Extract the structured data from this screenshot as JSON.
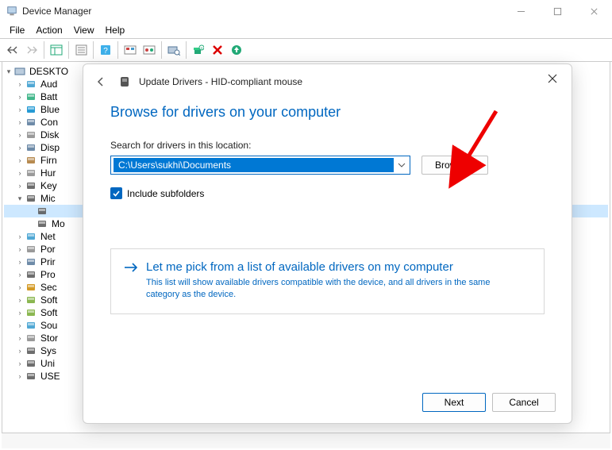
{
  "window": {
    "title": "Device Manager",
    "menu": [
      "File",
      "Action",
      "View",
      "Help"
    ]
  },
  "tree": {
    "root": "DESKTO",
    "items": [
      {
        "label": "Aud",
        "icon": "audio"
      },
      {
        "label": "Batt",
        "icon": "battery"
      },
      {
        "label": "Blue",
        "icon": "bluetooth"
      },
      {
        "label": "Con",
        "icon": "computer"
      },
      {
        "label": "Disk",
        "icon": "disk"
      },
      {
        "label": "Disp",
        "icon": "display"
      },
      {
        "label": "Firn",
        "icon": "firmware"
      },
      {
        "label": "Hur",
        "icon": "hid"
      },
      {
        "label": "Key",
        "icon": "keyboard"
      },
      {
        "label": "Mic",
        "icon": "mouse",
        "expanded": true,
        "children": [
          {
            "label": "",
            "icon": "mouse",
            "selected": true
          },
          {
            "label": "Mo",
            "icon": "mouse"
          }
        ]
      },
      {
        "label": "Net",
        "icon": "network"
      },
      {
        "label": "Por",
        "icon": "ports"
      },
      {
        "label": "Prir",
        "icon": "print"
      },
      {
        "label": "Pro",
        "icon": "cpu"
      },
      {
        "label": "Sec",
        "icon": "security"
      },
      {
        "label": "Soft",
        "icon": "soft"
      },
      {
        "label": "Soft",
        "icon": "soft"
      },
      {
        "label": "Sou",
        "icon": "sound"
      },
      {
        "label": "Stor",
        "icon": "storage"
      },
      {
        "label": "Sys",
        "icon": "system"
      },
      {
        "label": "Uni",
        "icon": "usb"
      },
      {
        "label": "USE",
        "icon": "usb"
      }
    ]
  },
  "dialog": {
    "title": "Update Drivers - HID-compliant mouse",
    "heading": "Browse for drivers on your computer",
    "location_label": "Search for drivers in this location:",
    "location_value": "C:\\Users\\sukhi\\Documents",
    "browse": "Browse...",
    "include_sub": "Include subfolders",
    "option_title": "Let me pick from a list of available drivers on my computer",
    "option_desc": "This list will show available drivers compatible with the device, and all drivers in the same category as the device.",
    "next": "Next",
    "cancel": "Cancel"
  }
}
